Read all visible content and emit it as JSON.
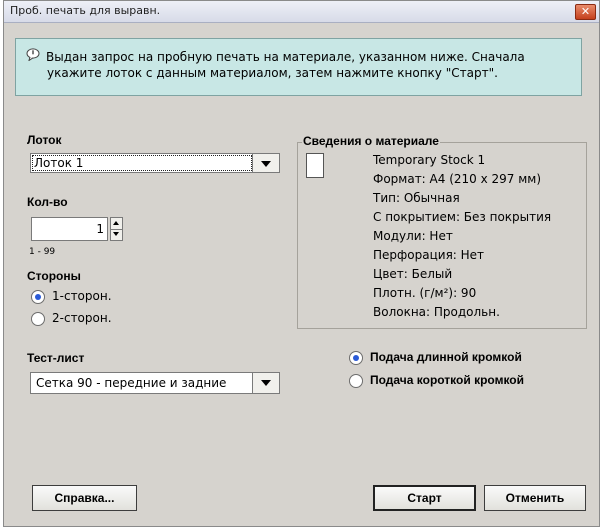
{
  "window": {
    "title": "Проб. печать для выравн.",
    "close_glyph": "✕"
  },
  "info": {
    "icon": "speech-balloon-icon",
    "line1": "Выдан запрос на пробную печать на материале, указанном ниже.  Сначала",
    "line2": "укажите лоток с данным материалом, затем нажмите кнопку \"Старт\"."
  },
  "tray": {
    "label": "Лоток",
    "value": "Лоток 1"
  },
  "quantity": {
    "label": "Кол-во",
    "value": "1",
    "range": "1 - 99"
  },
  "sides": {
    "label": "Стороны",
    "options": [
      {
        "label": "1-сторон.",
        "selected": true
      },
      {
        "label": "2-сторон.",
        "selected": false
      }
    ]
  },
  "test_sheet": {
    "label": "Тест-лист",
    "value": "Сетка 90 - передние и задние"
  },
  "feed": {
    "options": [
      {
        "label": "Подача длинной кромкой",
        "selected": true
      },
      {
        "label": "Подача короткой кромкой",
        "selected": false
      }
    ]
  },
  "material": {
    "title": "Сведения о материале",
    "lines": [
      "Temporary Stock 1",
      "Формат: А4 (210 х 297 мм)",
      "Тип:  Обычная",
      "С покрытием: Без покрытия",
      "Модули: Нет",
      "Перфорация: Нет",
      "Цвет: Белый",
      "Плотн. (г/м²): 90",
      "Волокна: Продольн."
    ]
  },
  "buttons": {
    "help": "Справка...",
    "start": "Старт",
    "cancel": "Отменить"
  },
  "colors": {
    "dialog_bg": "#d6d3ce",
    "info_bg": "#c8e7e5",
    "radio_dot": "#2a5ad7",
    "close_btn": "#c4401d"
  }
}
